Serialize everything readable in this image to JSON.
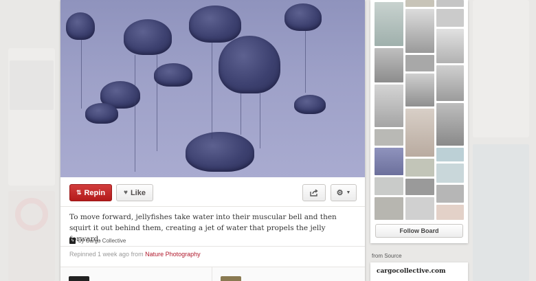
{
  "pin": {
    "actions": {
      "repin_label": "Repin",
      "like_label": "Like"
    },
    "description": "To move forward, jellyfishes take water into their muscular bell and then squirt it out behind them, creating a jet of water that propels the jelly forward.",
    "source_name": "by Cargo Collective",
    "repinned_text": "Repinned 1 week ago from",
    "repinned_board": "Nature Photography"
  },
  "board": {
    "follow_label": "Follow Board"
  },
  "source": {
    "heading": "from Source",
    "url": "cargocollective.com"
  },
  "colors": {
    "repin_red": "#b31b1b",
    "link_red": "#b0192c",
    "jellyfish_tint": "#9ea1c8"
  },
  "icons": [
    "pin-icon",
    "heart-icon",
    "share-icon",
    "gear-icon",
    "chevron-down-icon",
    "lightning-icon"
  ]
}
